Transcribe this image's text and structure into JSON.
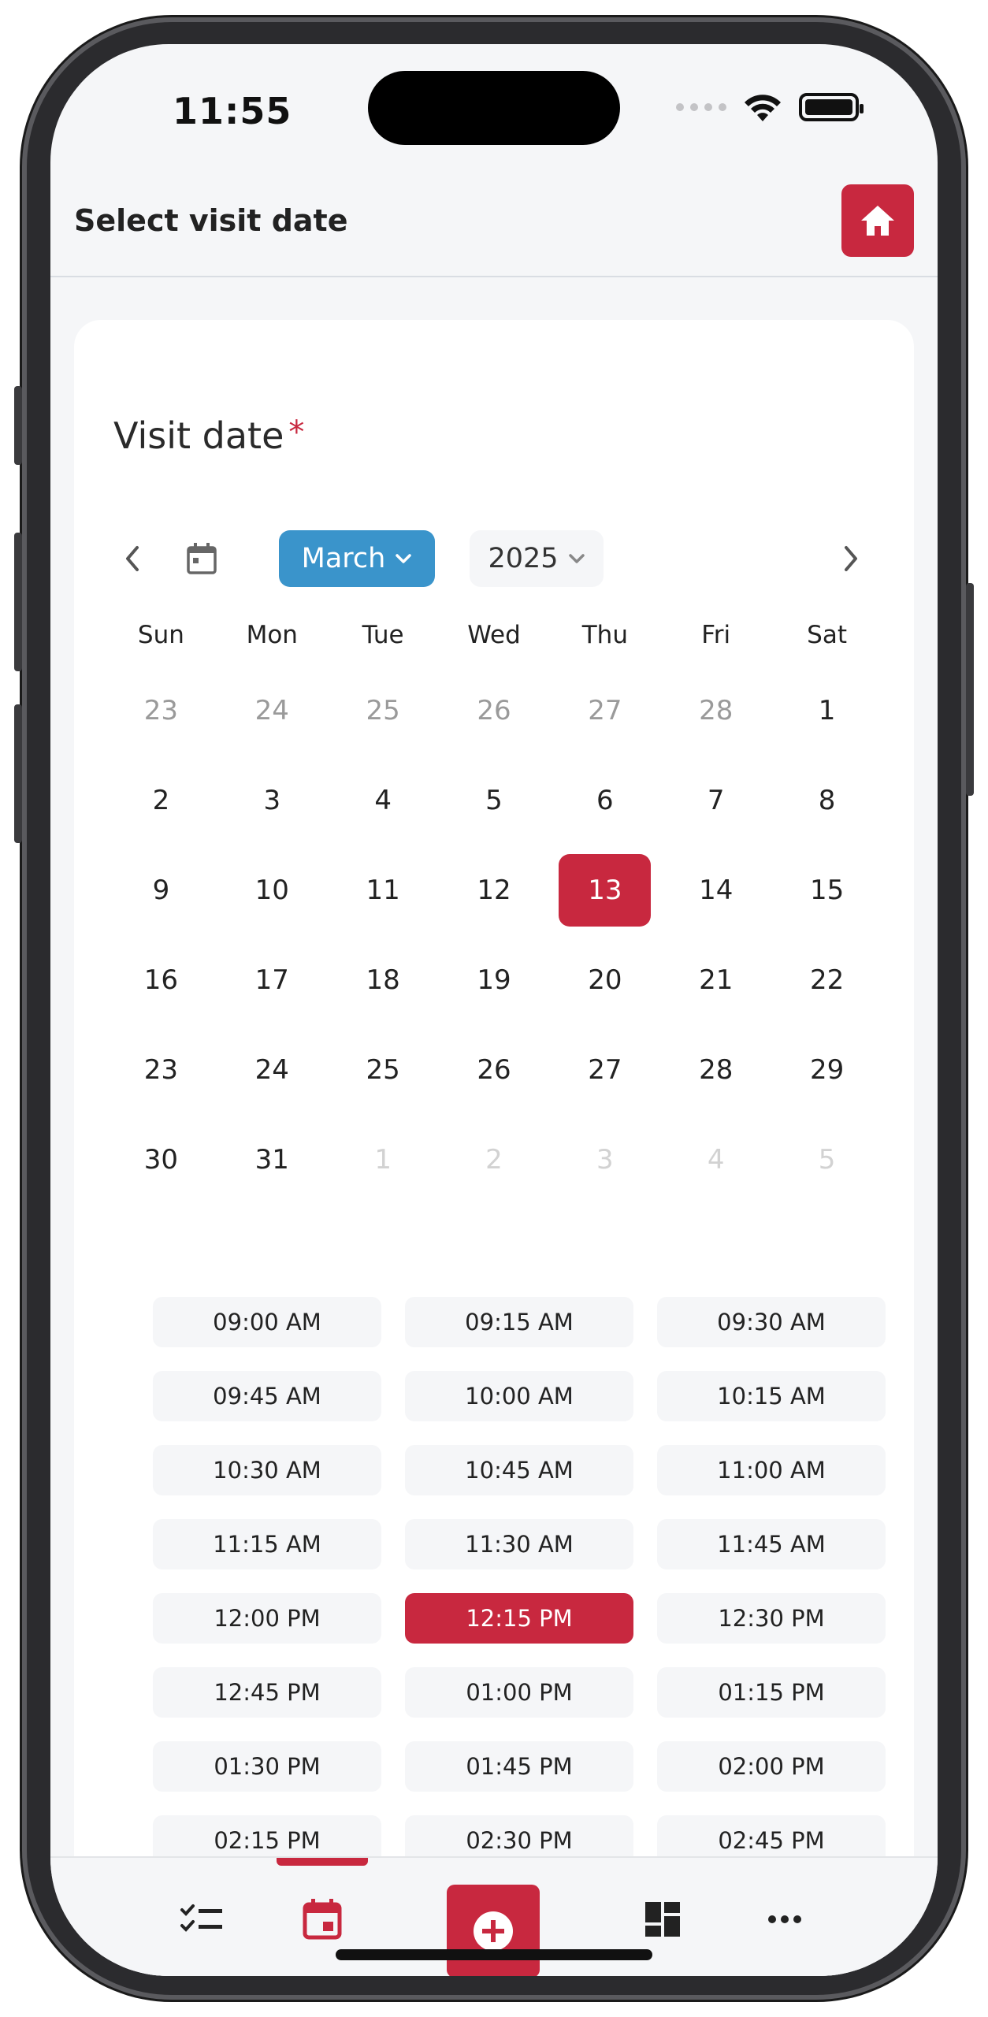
{
  "status_bar": {
    "time": "11:55"
  },
  "header": {
    "title": "Select visit date",
    "home_icon": "home-icon"
  },
  "form": {
    "field_label": "Visit date",
    "required_mark": "*",
    "month": "March",
    "year": "2025"
  },
  "calendar": {
    "weekdays": [
      "Sun",
      "Mon",
      "Tue",
      "Wed",
      "Thu",
      "Fri",
      "Sat"
    ],
    "days": [
      {
        "label": "23",
        "state": "out"
      },
      {
        "label": "24",
        "state": "out"
      },
      {
        "label": "25",
        "state": "out"
      },
      {
        "label": "26",
        "state": "out"
      },
      {
        "label": "27",
        "state": "out"
      },
      {
        "label": "28",
        "state": "out"
      },
      {
        "label": "1",
        "state": "in"
      },
      {
        "label": "2",
        "state": "in"
      },
      {
        "label": "3",
        "state": "in"
      },
      {
        "label": "4",
        "state": "in"
      },
      {
        "label": "5",
        "state": "in"
      },
      {
        "label": "6",
        "state": "in"
      },
      {
        "label": "7",
        "state": "in"
      },
      {
        "label": "8",
        "state": "in"
      },
      {
        "label": "9",
        "state": "in"
      },
      {
        "label": "10",
        "state": "in"
      },
      {
        "label": "11",
        "state": "in"
      },
      {
        "label": "12",
        "state": "in"
      },
      {
        "label": "13",
        "state": "selected"
      },
      {
        "label": "14",
        "state": "in"
      },
      {
        "label": "15",
        "state": "in"
      },
      {
        "label": "16",
        "state": "in"
      },
      {
        "label": "17",
        "state": "in"
      },
      {
        "label": "18",
        "state": "in"
      },
      {
        "label": "19",
        "state": "in"
      },
      {
        "label": "20",
        "state": "in"
      },
      {
        "label": "21",
        "state": "in"
      },
      {
        "label": "22",
        "state": "in"
      },
      {
        "label": "23",
        "state": "in"
      },
      {
        "label": "24",
        "state": "in"
      },
      {
        "label": "25",
        "state": "in"
      },
      {
        "label": "26",
        "state": "in"
      },
      {
        "label": "27",
        "state": "in"
      },
      {
        "label": "28",
        "state": "in"
      },
      {
        "label": "29",
        "state": "in"
      },
      {
        "label": "30",
        "state": "in"
      },
      {
        "label": "31",
        "state": "in"
      },
      {
        "label": "1",
        "state": "faded"
      },
      {
        "label": "2",
        "state": "faded"
      },
      {
        "label": "3",
        "state": "faded"
      },
      {
        "label": "4",
        "state": "faded"
      },
      {
        "label": "5",
        "state": "faded"
      }
    ]
  },
  "time_slots": {
    "items": [
      "09:00 AM",
      "09:15 AM",
      "09:30 AM",
      "09:45 AM",
      "10:00 AM",
      "10:15 AM",
      "10:30 AM",
      "10:45 AM",
      "11:00 AM",
      "11:15 AM",
      "11:30 AM",
      "11:45 AM",
      "12:00 PM",
      "12:15 PM",
      "12:30 PM",
      "12:45 PM",
      "01:00 PM",
      "01:15 PM",
      "01:30 PM",
      "01:45 PM",
      "02:00 PM",
      "02:15 PM",
      "02:30 PM",
      "02:45 PM"
    ],
    "selected": "12:15 PM"
  },
  "bottom_nav": {
    "items": [
      "checklist-icon",
      "calendar-icon",
      "add-circle-icon",
      "dashboard-icon",
      "more-icon"
    ],
    "active": "calendar-icon"
  },
  "colors": {
    "accent": "#c8283f",
    "month_select": "#3a94cb",
    "background": "#f5f6f8"
  }
}
